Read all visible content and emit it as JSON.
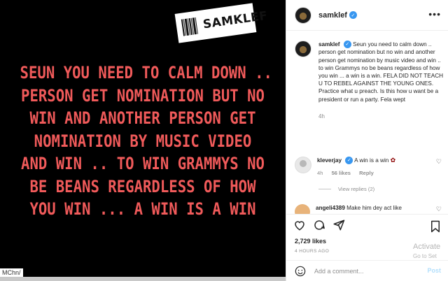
{
  "image": {
    "tag_text": "SAMKLEF",
    "quote": "SEUN YOU NEED TO CALM DOWN ..\nPERSON GET NOMINATION BUT NO\nWIN AND ANOTHER PERSON GET\nNOMINATION BY MUSIC VIDEO\nAND WIN .. TO WIN GRAMMYS NO\nBE BEANS REGARDLESS OF HOW\nYOU WIN ... A WIN IS A WIN",
    "text_color": "#f05a5a",
    "url_fragment": "MChn/"
  },
  "header": {
    "username": "samklef",
    "verified_icon": "verified-badge-icon"
  },
  "caption": {
    "username": "samklef",
    "text": "Seun you need to calm down .. person get nomination but no win and another person get nomination by music video and win .. to win Grammys no be beans regardless of how you win ... a win is a win. FELA DID NOT TEACH U TO REBEL AGAINST THE YOUNG ONES. Practice what u preach. Is this how u want be a president or run a party. Fela wept",
    "time": "4h"
  },
  "comments": [
    {
      "username": "kleverjay",
      "text": "A win is a win",
      "time": "4h",
      "likes": "56 likes",
      "reply": "Reply"
    },
    {
      "username": "angeli4389",
      "text": "Make him dey act like"
    }
  ],
  "view_replies": "View replies (2)",
  "likes": "2,729 likes",
  "timestamp": "4 HOURS AGO",
  "add_comment": {
    "placeholder": "Add a comment...",
    "post_label": "Post"
  },
  "watermark": {
    "line1": "Activate",
    "line2": "Go to Set"
  },
  "colors": {
    "accent": "#3897f0",
    "post_button": "#b2dffc"
  }
}
